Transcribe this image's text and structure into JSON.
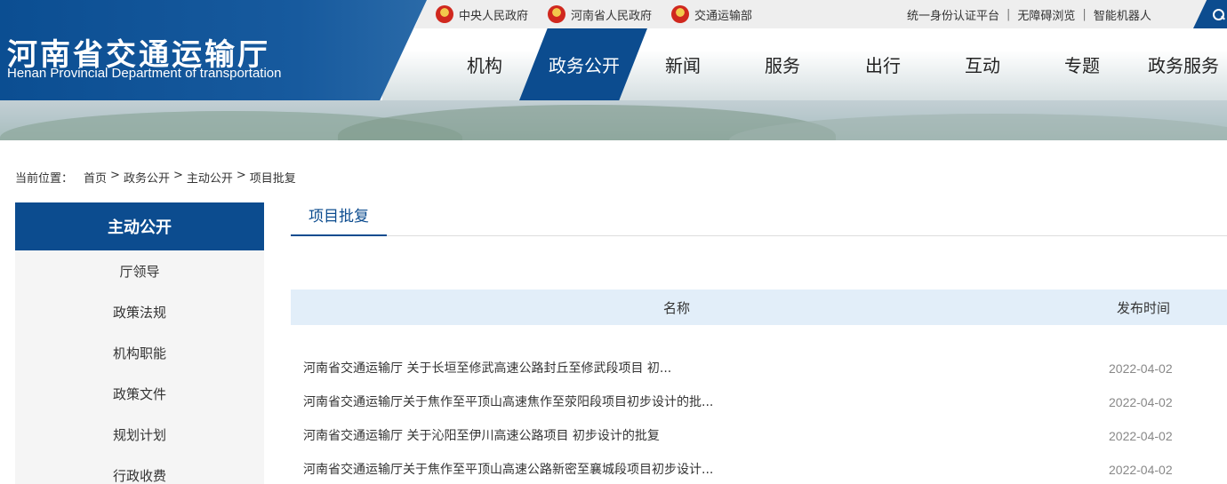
{
  "header": {
    "title_cn": "河南省交通运输厅",
    "title_en": "Henan Provincial Department of transportation",
    "gov_links": [
      {
        "label": "中央人民政府",
        "icon": "national-emblem-icon"
      },
      {
        "label": "河南省人民政府",
        "icon": "national-emblem-icon"
      },
      {
        "label": "交通运输部",
        "icon": "national-emblem-icon"
      }
    ],
    "util_links": [
      "统一身份认证平台",
      "无障碍浏览",
      "智能机器人"
    ],
    "util_sep": "|",
    "search_icon": "search-icon",
    "nav": [
      "机构",
      "政务公开",
      "新闻",
      "服务",
      "出行",
      "互动",
      "专题",
      "政务服务"
    ],
    "nav_active": "政务公开",
    "accent_color": "#0c4c8f"
  },
  "breadcrumb": {
    "prefix": "当前位置：",
    "items": [
      "首页",
      "政务公开",
      "主动公开",
      "项目批复"
    ],
    "separator": ">"
  },
  "sidebar": {
    "title": "主动公开",
    "items": [
      "厅领导",
      "政策法规",
      "机构职能",
      "政策文件",
      "规划计划",
      "行政收费"
    ]
  },
  "main": {
    "tab": "项目批复",
    "columns": {
      "name": "名称",
      "date": "发布时间"
    },
    "rows": [
      {
        "title": "河南省交通运输厅 关于长垣至修武高速公路封丘至修武段项目 初...",
        "date": "2022-04-02"
      },
      {
        "title": "河南省交通运输厅关于焦作至平顶山高速焦作至荥阳段项目初步设计的批...",
        "date": "2022-04-02"
      },
      {
        "title": "河南省交通运输厅 关于沁阳至伊川高速公路项目 初步设计的批复",
        "date": "2022-04-02"
      },
      {
        "title": "河南省交通运输厅关于焦作至平顶山高速公路新密至襄城段项目初步设计...",
        "date": "2022-04-02"
      }
    ]
  }
}
